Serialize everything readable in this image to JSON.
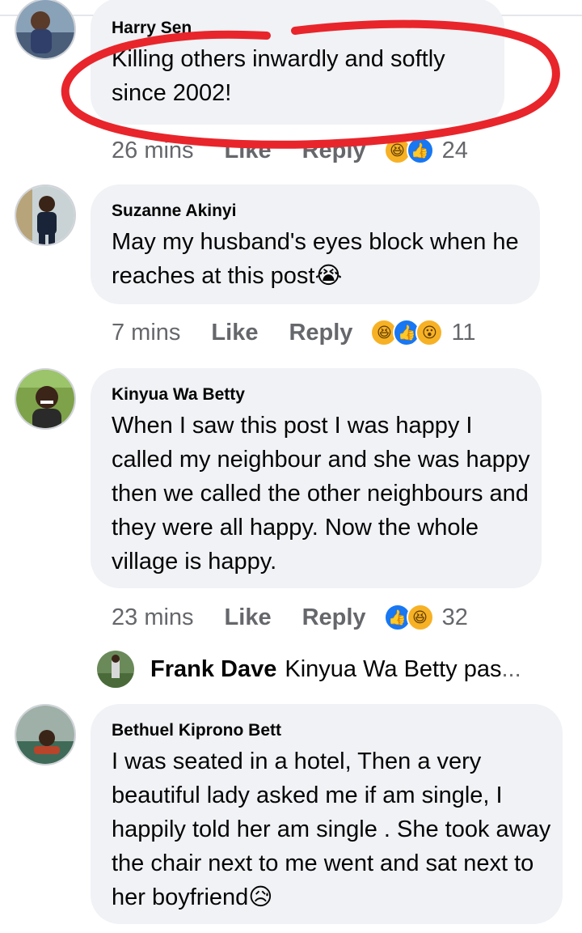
{
  "colors": {
    "bubble": "#f0f2f5",
    "meta": "#65676b",
    "annotation": "#e8252b",
    "like_blue": "#1877f2"
  },
  "comments": [
    {
      "author": "Harry Sen",
      "text": "Killing others inwardly and softly since 2002!",
      "time": "26 mins",
      "like": "Like",
      "reply": "Reply",
      "reactions": [
        "haha-icon",
        "like-icon"
      ],
      "count": "24"
    },
    {
      "author": "Suzanne Akinyi",
      "text": "May my husband's eyes block when he reaches at this post😭",
      "time": "7 mins",
      "like": "Like",
      "reply": "Reply",
      "reactions": [
        "haha-icon",
        "like-icon",
        "wow-icon"
      ],
      "count": "11"
    },
    {
      "author": "Kinyua Wa Betty",
      "text": "When I saw this post I was happy I called my neighbour and she was happy then we called the other neighbours and they were all happy. Now the whole village is happy.",
      "time": "23 mins",
      "like": "Like",
      "reply": "Reply",
      "reactions": [
        "like-icon",
        "haha-icon"
      ],
      "count": "32"
    },
    {
      "author": "Bethuel Kiprono Bett",
      "text": "I was seated in a hotel, Then a very beautiful lady asked me if am single, I happily told her am single . She took away the chair next to me went and sat next to her boyfriend😥"
    }
  ],
  "reply_preview": {
    "name": "Frank Dave",
    "text": "Kinyua Wa Betty pas",
    "ellipsis": "..."
  }
}
